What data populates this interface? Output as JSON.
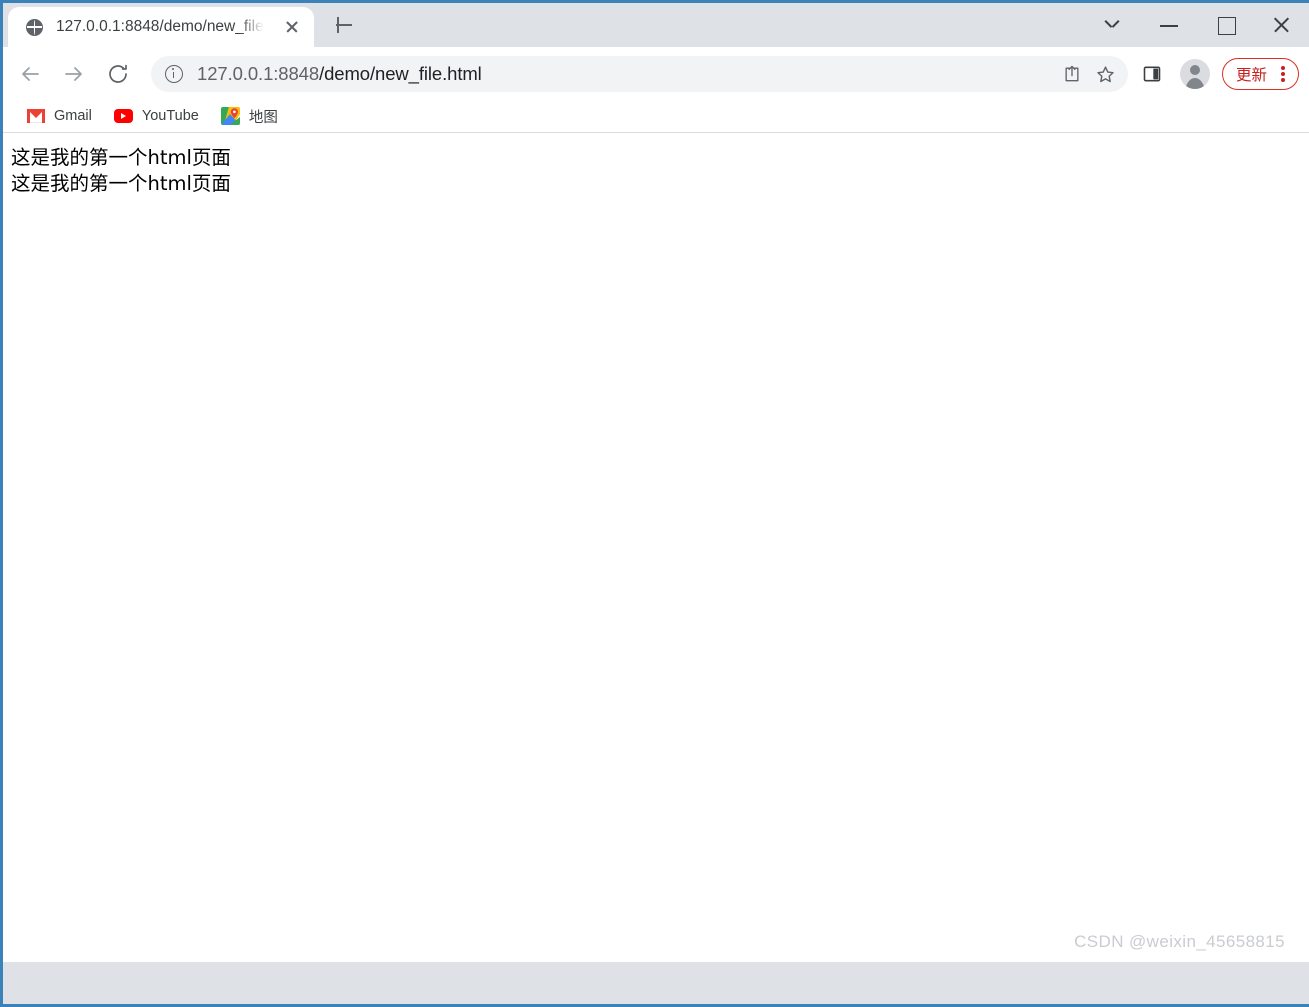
{
  "browser": {
    "accent_blue": "#3a82b8",
    "tabstrip_bg": "#dee1e6",
    "tab": {
      "title": "127.0.0.1:8848/demo/new_file",
      "favicon": "globe-icon",
      "close_label": "×"
    },
    "newtab_label": "+",
    "window_controls": {
      "tab_search": "chevron-down-icon",
      "minimize": "minimize-icon",
      "maximize": "maximize-icon",
      "close": "close-icon"
    },
    "nav": {
      "back": "back-arrow-icon",
      "forward": "forward-arrow-icon",
      "reload": "reload-icon"
    },
    "omnibox": {
      "site_info_icon": "info-circle-icon",
      "url_host": "127.0.0.1:8848",
      "url_path": "/demo/new_file.html",
      "share_icon": "share-icon",
      "bookmark_icon": "star-icon"
    },
    "toolbar": {
      "side_panel_icon": "side-panel-icon",
      "profile_icon": "profile-avatar-icon",
      "update_label": "更新",
      "update_accent": "#c5221f",
      "menu_icon": "three-dot-menu-icon"
    },
    "bookmarks": [
      {
        "label": "Gmail",
        "icon": "gmail-icon"
      },
      {
        "label": "YouTube",
        "icon": "youtube-icon"
      },
      {
        "label": "地图",
        "icon": "google-maps-icon"
      }
    ]
  },
  "page": {
    "lines": [
      "这是我的第一个html页面",
      "这是我的第一个html页面"
    ]
  },
  "watermark": "CSDN @weixin_45658815"
}
